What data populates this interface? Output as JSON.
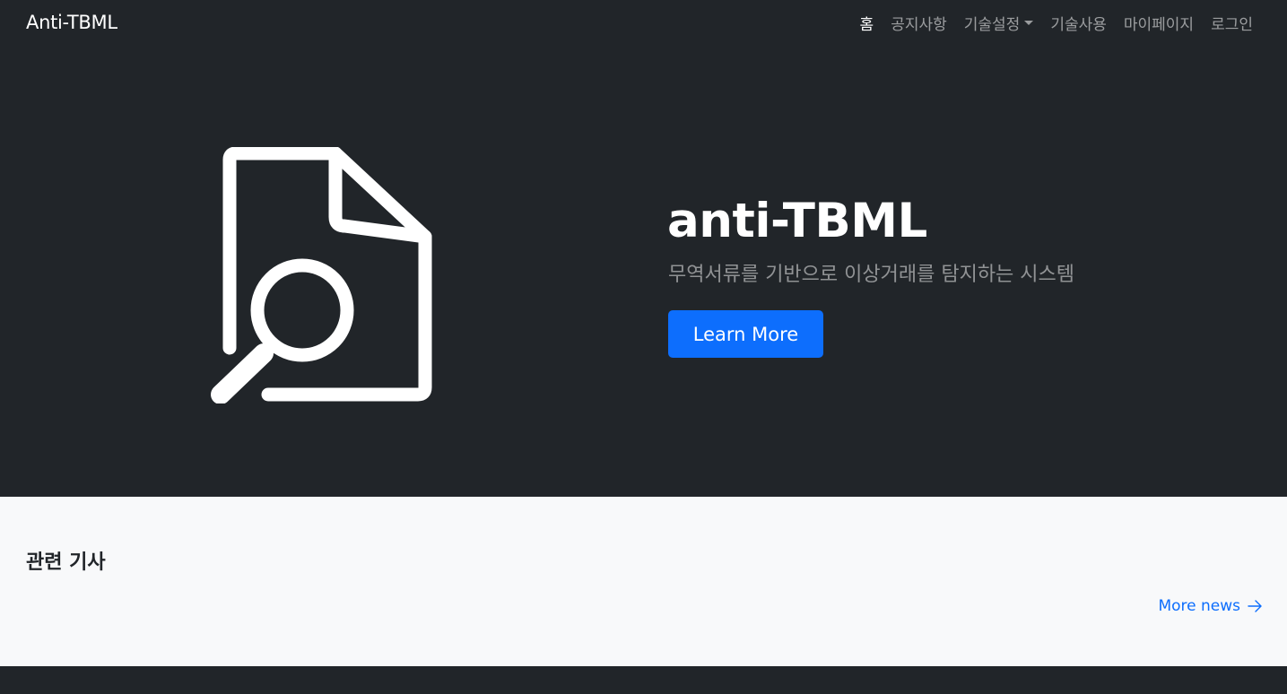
{
  "navbar": {
    "brand": "Anti-TBML",
    "items": [
      {
        "label": "홈",
        "active": true
      },
      {
        "label": "공지사항",
        "active": false
      },
      {
        "label": "기술설정",
        "active": false,
        "dropdown": true
      },
      {
        "label": "기술사용",
        "active": false
      },
      {
        "label": "마이페이지",
        "active": false
      },
      {
        "label": "로그인",
        "active": false
      }
    ]
  },
  "hero": {
    "icon": "file-search-icon",
    "title": "anti-TBML",
    "lead": "무역서류를 기반으로 이상거래를 탐지하는 시스템",
    "button_label": "Learn More"
  },
  "news": {
    "heading": "관련 기사",
    "more_label": "More news",
    "more_icon": "arrow-right-icon"
  },
  "colors": {
    "dark_bg": "#212529",
    "light_bg": "#f8f9fa",
    "primary": "#0d6efd",
    "white": "#ffffff"
  }
}
